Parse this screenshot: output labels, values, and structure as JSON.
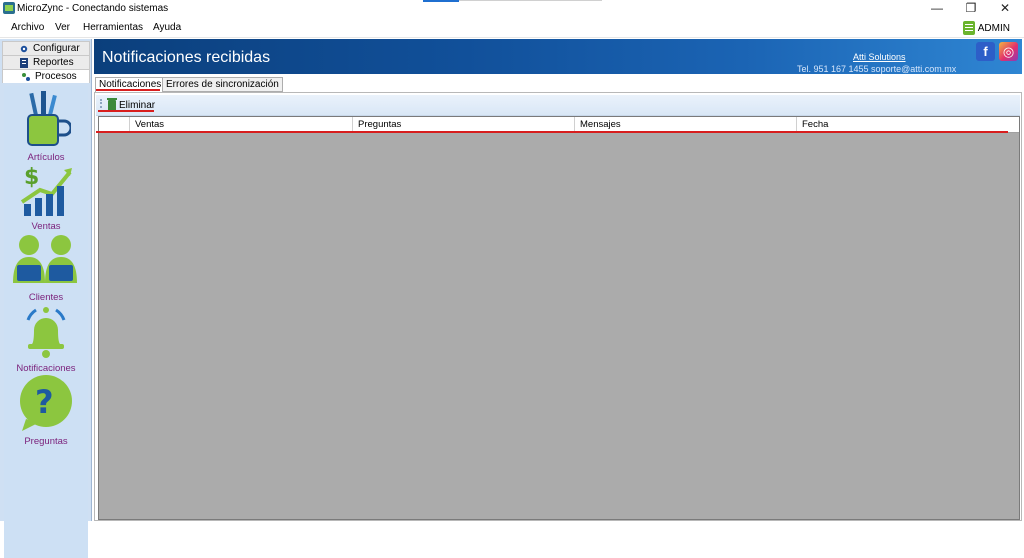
{
  "window": {
    "title": "MicroZync - Conectando sistemas",
    "controls": {
      "minimize": "—",
      "restore": "❐",
      "close": "✕"
    }
  },
  "menu": {
    "items": [
      "Archivo",
      "Ver",
      "Herramientas",
      "Ayuda"
    ],
    "user": "ADMIN"
  },
  "nav": {
    "tabs": [
      "Configurar",
      "Reportes",
      "Procesos"
    ]
  },
  "launcher": {
    "items": [
      {
        "label": "Artículos",
        "icon": "pencil-cup-icon"
      },
      {
        "label": "Ventas",
        "icon": "sales-growth-icon"
      },
      {
        "label": "Clientes",
        "icon": "clients-icon"
      },
      {
        "label": "Notificaciones",
        "icon": "bell-icon"
      },
      {
        "label": "Preguntas",
        "icon": "question-bubble-icon"
      }
    ]
  },
  "header": {
    "title": "Notificaciones recibidas",
    "company": "Atti Solutions",
    "contact": "Tel. 951 167 1455  soporte@atti.com.mx",
    "social": {
      "facebook": "f",
      "instagram": "◎"
    }
  },
  "tabs": [
    "Notificaciones",
    "Errores de sincronización"
  ],
  "toolbar": {
    "delete_label": "Eliminar"
  },
  "grid": {
    "columns": [
      "Ventas",
      "Preguntas",
      "Mensajes",
      "Fecha"
    ],
    "rows": []
  },
  "colors": {
    "accent": "#11509a",
    "highlight": "#d81e1e",
    "launcher_text": "#7a1f7a",
    "grid_empty": "#ababab"
  }
}
